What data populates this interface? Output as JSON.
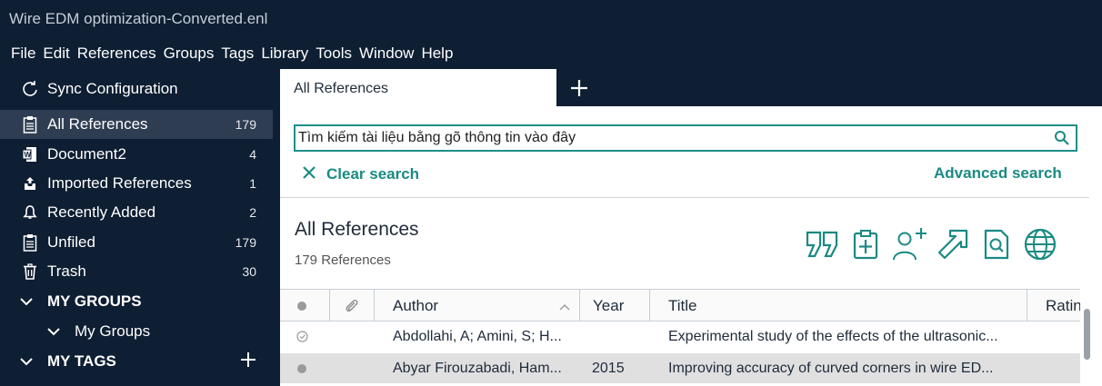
{
  "window": {
    "title": "Wire EDM optimization-Converted.enl"
  },
  "menu": [
    "File",
    "Edit",
    "References",
    "Groups",
    "Tags",
    "Library",
    "Tools",
    "Window",
    "Help"
  ],
  "sidebar": {
    "sync": "Sync Configuration",
    "items": [
      {
        "label": "All References",
        "count": "179",
        "icon": "clipboard-icon"
      },
      {
        "label": "Document2",
        "count": "4",
        "icon": "word-document-icon"
      },
      {
        "label": "Imported References",
        "count": "1",
        "icon": "import-tray-icon"
      },
      {
        "label": "Recently Added",
        "count": "2",
        "icon": "bell-icon"
      },
      {
        "label": "Unfiled",
        "count": "179",
        "icon": "clipboard-icon"
      },
      {
        "label": "Trash",
        "count": "30",
        "icon": "trash-icon"
      }
    ],
    "my_groups": "MY GROUPS",
    "my_groups_sub": "My Groups",
    "my_tags": "MY TAGS"
  },
  "tabs": [
    {
      "label": "All References"
    }
  ],
  "search": {
    "value": "Tìm kiếm tài liệu bằng gõ thông tin vào đây",
    "clear_label": "Clear search",
    "advanced_label": "Advanced search"
  },
  "library": {
    "title": "All References",
    "count_text": "179 References"
  },
  "toolbar_icons": [
    "quote-icon",
    "clipboard-add-icon",
    "add-user-icon",
    "share-arrow-icon",
    "find-pdf-icon",
    "globe-icon"
  ],
  "table": {
    "columns": [
      "Author",
      "Year",
      "Title",
      "Ratin"
    ],
    "rows": [
      {
        "author": "Abdollahi, A; Amini, S; H...",
        "year": "",
        "title": "Experimental study of the effects of the ultrasonic...",
        "status": "read"
      },
      {
        "author": "Abyar Firouzabadi, Ham...",
        "year": "2015",
        "title": "Improving accuracy of curved corners in wire ED...",
        "status": "unread"
      }
    ]
  },
  "colors": {
    "navy": "#0e1e33",
    "teal": "#1a8a83",
    "selected": "#2f3d52"
  }
}
